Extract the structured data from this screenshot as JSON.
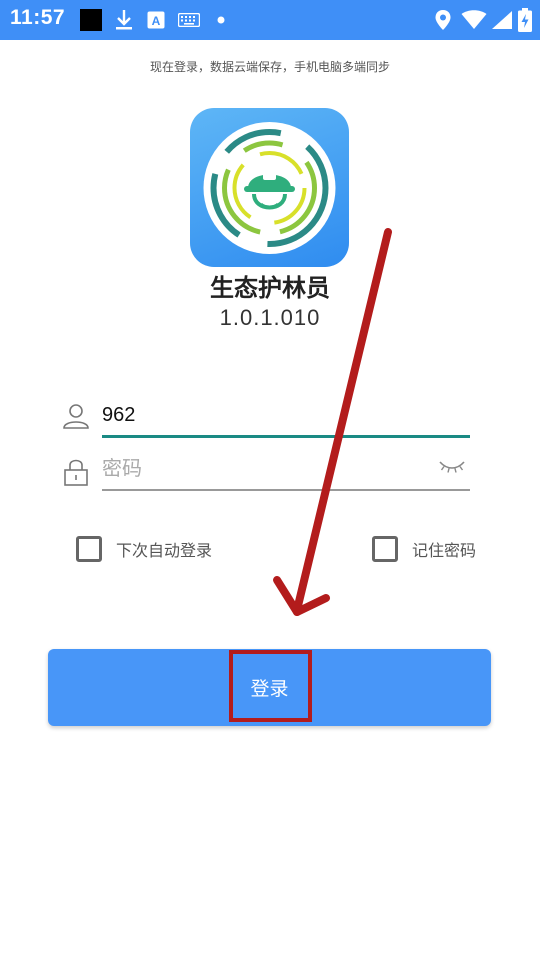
{
  "status_bar": {
    "time": "11:57",
    "bg_color": "#3f8ff7",
    "icons": [
      "notification-square-icon",
      "download-icon",
      "font-icon",
      "keyboard-icon",
      "dot-icon",
      "location-icon",
      "wifi-icon",
      "signal-icon",
      "battery-charging-icon"
    ]
  },
  "header": {
    "subtitle": "现在登录，数据云端保存，手机电脑多端同步"
  },
  "app": {
    "name": "生态护林员",
    "version": "1.0.1.010"
  },
  "form": {
    "username": {
      "value": "962",
      "icon": "user-icon"
    },
    "password": {
      "value": "",
      "placeholder": "密码",
      "icon": "lock-icon",
      "toggle_icon": "eye-closed-icon"
    },
    "auto_login_label": "下次自动登录",
    "remember_password_label": "记住密码",
    "auto_login_checked": false,
    "remember_password_checked": false
  },
  "login_button": {
    "label": "登录",
    "color": "#4896f8"
  },
  "annotation": {
    "arrow_color": "#b31c1c"
  }
}
